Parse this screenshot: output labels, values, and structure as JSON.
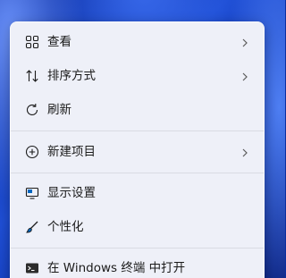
{
  "menu": {
    "items": [
      {
        "label": "查看",
        "icon": "grid-icon",
        "has_submenu": true
      },
      {
        "label": "排序方式",
        "icon": "sort-icon",
        "has_submenu": true
      },
      {
        "label": "刷新",
        "icon": "refresh-icon",
        "has_submenu": false
      },
      {
        "label": "新建项目",
        "icon": "new-item-icon",
        "has_submenu": true
      },
      {
        "label": "显示设置",
        "icon": "display-icon",
        "has_submenu": false
      },
      {
        "label": "个性化",
        "icon": "brush-icon",
        "has_submenu": false
      },
      {
        "label": "在 Windows 终端 中打开",
        "icon": "terminal-icon",
        "has_submenu": false
      }
    ]
  },
  "colors": {
    "menu_background": "#eef0f8",
    "text": "#1b1b1b",
    "divider": "#d9dbe3",
    "accent": "#0067c0"
  }
}
